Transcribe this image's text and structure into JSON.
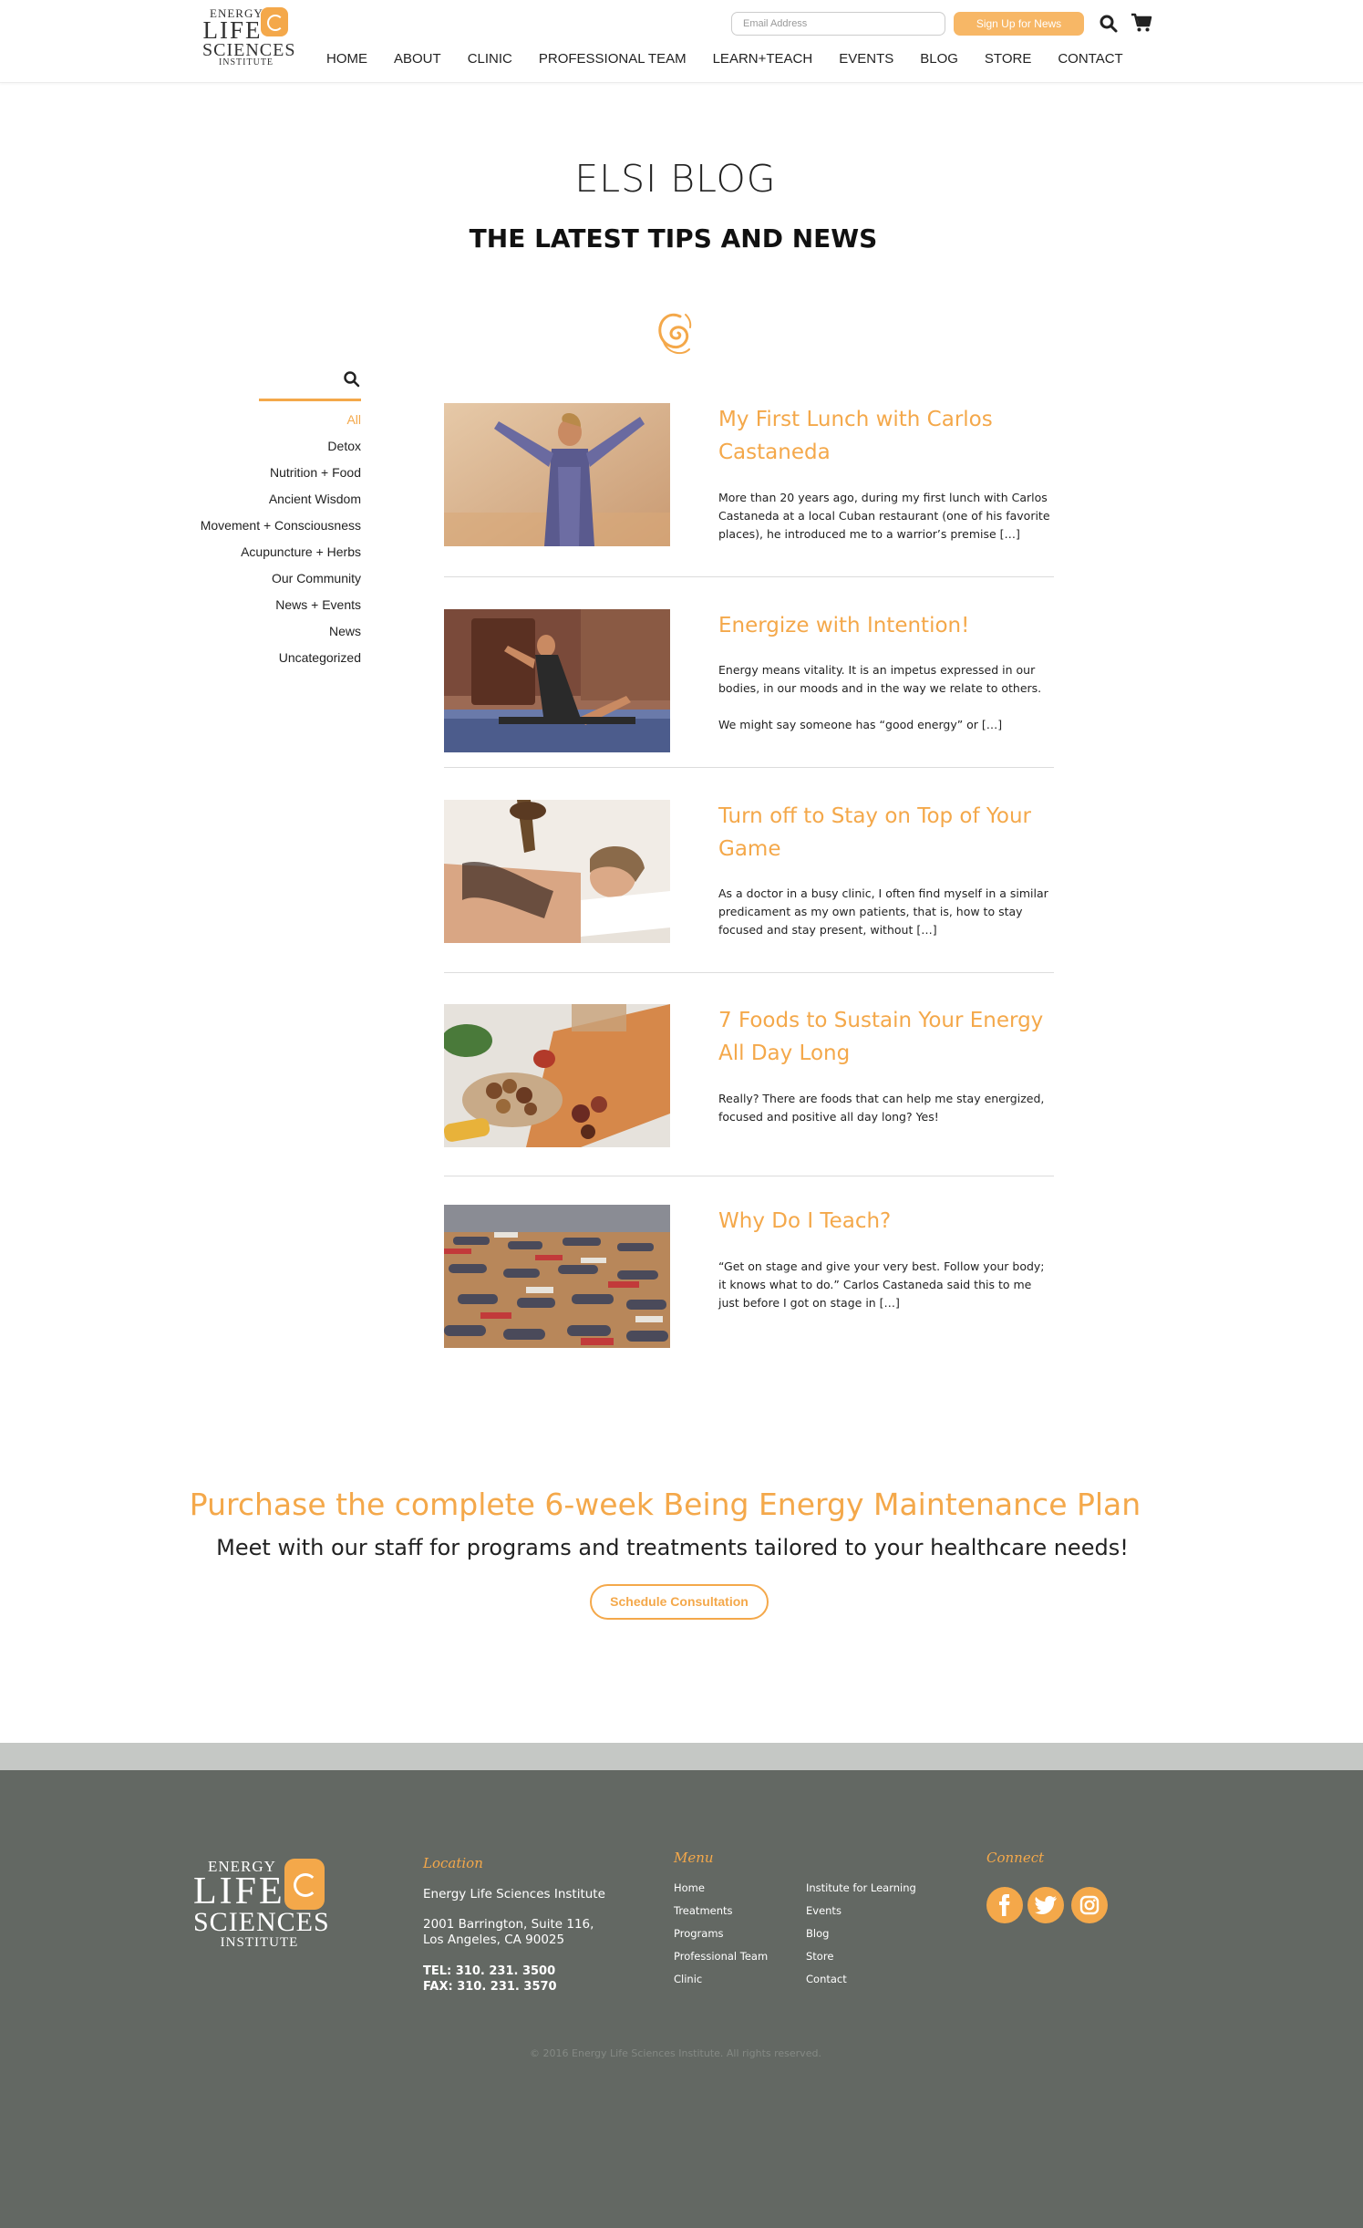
{
  "header": {
    "logo": {
      "line1": "ENERGY",
      "line2": "LIFE",
      "line3": "SCIENCES",
      "line4": "INSTITUTE"
    },
    "email_placeholder": "Email Address",
    "signup_label": "Sign Up for News",
    "search_icon": "search-icon",
    "cart_icon": "cart-icon"
  },
  "nav": {
    "items": [
      "HOME",
      "ABOUT",
      "CLINIC",
      "PROFESSIONAL TEAM",
      "LEARN+TEACH",
      "EVENTS",
      "BLOG",
      "STORE",
      "CONTACT"
    ]
  },
  "hero": {
    "title": "ELSI BLOG",
    "subtitle": "THE LATEST TIPS AND NEWS"
  },
  "sidebar": {
    "categories": [
      "All",
      "Detox",
      "Nutrition + Food",
      "Ancient Wisdom",
      "Movement + Consciousness",
      "Acupuncture + Herbs",
      "Our Community",
      "News + Events",
      "News",
      "Uncategorized"
    ],
    "active": "All"
  },
  "posts": [
    {
      "title": "My First Lunch with Carlos Castaneda",
      "excerpt": "More than 20 years ago, during my first lunch with Carlos Castaneda at a local Cuban restaurant (one of his favorite places), he introduced me to a warrior’s premise […]"
    },
    {
      "title": "Energize with Intention!",
      "excerpt": "Energy means vitality. It is an impetus expressed in our bodies, in our moods and in the way we relate to others.\n\nWe might say someone has “good energy” or […]"
    },
    {
      "title": "Turn off to Stay on Top of Your Game",
      "excerpt": "As a doctor in a busy clinic, I often find myself in a similar predicament as my own patients, that is, how to stay focused and stay present, without […]"
    },
    {
      "title": "7 Foods to Sustain Your Energy All Day Long",
      "excerpt": "Really? There are foods that can help me stay energized, focused and positive all day long? Yes!"
    },
    {
      "title": "Why Do I Teach?",
      "excerpt": "“Get on stage and give your very best. Follow your body; it knows what to do.” Carlos Castaneda said this to me just before I got on stage in […]"
    }
  ],
  "cta": {
    "title": "Purchase the complete 6-week Being Energy Maintenance Plan",
    "subtitle": "Meet with our staff for programs and treatments tailored to your healthcare needs!",
    "button": "Schedule Consultation"
  },
  "footer": {
    "logo": {
      "line1": "ENERGY",
      "line2": "LIFE",
      "line3": "SCIENCES",
      "line4": "INSTITUTE"
    },
    "location": {
      "heading": "Location",
      "name": "Energy Life Sciences Institute",
      "address1": "2001 Barrington, Suite 116,",
      "address2": "Los Angeles, CA 90025",
      "tel": "TEL: 310. 231. 3500",
      "fax": "FAX: 310. 231. 3570"
    },
    "menu": {
      "heading": "Menu",
      "col1": [
        "Home",
        "Treatments",
        "Programs",
        "Professional Team",
        "Clinic"
      ],
      "col2": [
        "Institute for Learning",
        "Events",
        "Blog",
        "Store",
        "Contact"
      ]
    },
    "connect": {
      "heading": "Connect",
      "icons": [
        "facebook-icon",
        "twitter-icon",
        "instagram-icon"
      ]
    },
    "copyright": "© 2016 Energy Life Sciences Institute. All rights reserved."
  },
  "colors": {
    "accent": "#f4a84a",
    "footer_bg": "#636863",
    "footer_band": "#c5c8c5"
  }
}
